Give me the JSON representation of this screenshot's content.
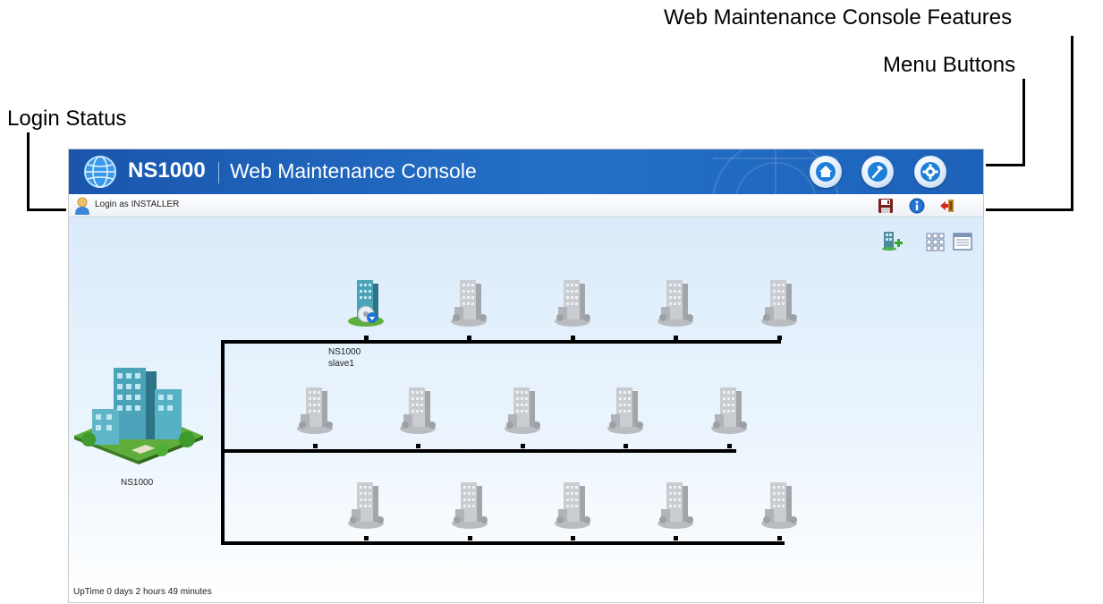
{
  "annotations": {
    "features": "Web Maintenance Console Features",
    "menu_buttons": "Menu Buttons",
    "login_status": "Login Status"
  },
  "header": {
    "brand": "NS1000",
    "title": "Web Maintenance Console",
    "menu_buttons": [
      {
        "icon": "home-icon"
      },
      {
        "icon": "tool-icon"
      },
      {
        "icon": "gear-icon"
      }
    ]
  },
  "status_bar": {
    "login_text": "Login as INSTALLER",
    "tools": [
      "save-icon",
      "info-icon",
      "logout-icon"
    ]
  },
  "view_controls": [
    "add-site-icon",
    "grid-view-icon",
    "list-view-icon"
  ],
  "network": {
    "master_label": "NS1000",
    "nodes": [
      {
        "row": 1,
        "col": 1,
        "state": "registered",
        "label_line1": "NS1000",
        "label_line2": "slave1"
      },
      {
        "row": 1,
        "col": 2,
        "state": "empty"
      },
      {
        "row": 1,
        "col": 3,
        "state": "empty"
      },
      {
        "row": 1,
        "col": 4,
        "state": "empty"
      },
      {
        "row": 1,
        "col": 5,
        "state": "empty"
      },
      {
        "row": 2,
        "col": 1,
        "state": "empty"
      },
      {
        "row": 2,
        "col": 2,
        "state": "empty"
      },
      {
        "row": 2,
        "col": 3,
        "state": "empty"
      },
      {
        "row": 2,
        "col": 4,
        "state": "empty"
      },
      {
        "row": 2,
        "col": 5,
        "state": "empty"
      },
      {
        "row": 3,
        "col": 1,
        "state": "empty"
      },
      {
        "row": 3,
        "col": 2,
        "state": "empty"
      },
      {
        "row": 3,
        "col": 3,
        "state": "empty"
      },
      {
        "row": 3,
        "col": 4,
        "state": "empty"
      },
      {
        "row": 3,
        "col": 5,
        "state": "empty"
      }
    ]
  },
  "footer": {
    "uptime": "UpTime 0 days 2 hours 49 minutes"
  },
  "colors": {
    "header_blue": "#1a56ad",
    "background_top": "#d6e8fa",
    "line": "#000000"
  }
}
